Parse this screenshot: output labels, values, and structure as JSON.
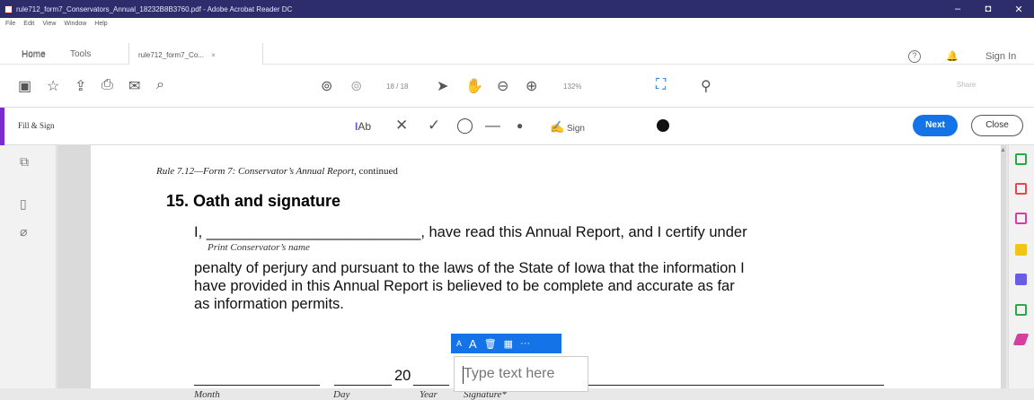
{
  "window": {
    "title": "rule712_form7_Conservators_Annual_18232B8B3760.pdf - Adobe Acrobat Reader DC",
    "minimize": "–",
    "maximize": "◘",
    "close": "✕"
  },
  "menu": [
    "File",
    "Edit",
    "View",
    "Window",
    "Help"
  ],
  "tabs": {
    "home": "Home",
    "tools": "Tools",
    "doc": "rule712_form7_Co...",
    "doc_close": "×"
  },
  "top_right": {
    "sign_in": "Sign In"
  },
  "toolbar": {
    "page_indicator": "18 / 18",
    "zoom": "132%",
    "share": "Share"
  },
  "fill_sign": {
    "label": "Fill & Sign",
    "text_tool": "Ab",
    "sign_label": "Sign",
    "next": "Next",
    "close": "Close"
  },
  "document": {
    "header_italic": "Rule 7.12—Form 7: Conservator’s Annual Report,",
    "header_plain": " continued",
    "section_title": "15. Oath and signature",
    "line1": "I, __________________________, have read this Annual Report, and I certify under",
    "print_name_caption": "Print Conservator’s name",
    "line2": "penalty of perjury and pursuant to the laws of the State of Iowa that the information I",
    "line3": "have provided in this Annual Report is believed to be complete and accurate as far",
    "line4": "as information permits.",
    "year_prefix": "20",
    "captions": {
      "month": "Month",
      "day": "Day",
      "year": "Year",
      "signature": "Signature*"
    }
  },
  "text_field": {
    "placeholder": "Type text here",
    "mini_toolbar": [
      "A",
      "A",
      "🗑",
      "▦",
      "···"
    ]
  },
  "colors": {
    "accent_blue": "#1473e6",
    "fill_sign_purple": "#7b2bd1",
    "title_bar": "#2d2d6b"
  }
}
